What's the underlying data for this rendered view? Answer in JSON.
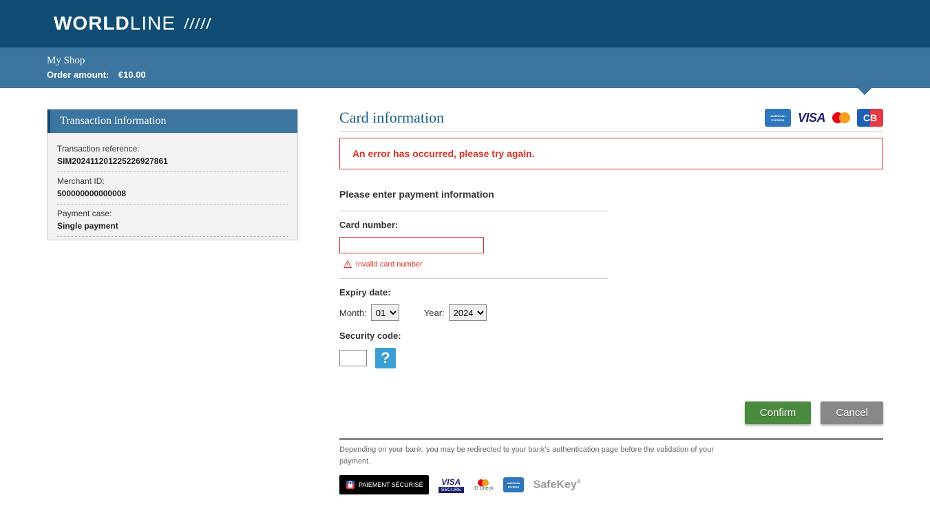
{
  "header": {
    "logo": {
      "bold": "WORLD",
      "light": "LINE"
    }
  },
  "order": {
    "shop_name": "My Shop",
    "amount_label": "Order amount:",
    "amount_value": "€10.00"
  },
  "transaction": {
    "panel_title": "Transaction information",
    "ref_label": "Transaction reference:",
    "ref_value": "SIM202411201225226927861",
    "merchant_label": "Merchant ID:",
    "merchant_value": "500000000000008",
    "case_label": "Payment case:",
    "case_value": "Single payment"
  },
  "card_form": {
    "title": "Card information",
    "error_banner": "An error has occurred, please try again.",
    "instruction": "Please enter payment information",
    "card_number_label": "Card number:",
    "card_number_value": "",
    "card_number_error": "Invalid card number",
    "expiry_label": "Expiry date:",
    "month_label": "Month:",
    "month_value": "01",
    "year_label": "Year:",
    "year_value": "2024",
    "cvv_label": "Security code:",
    "cvv_value": "",
    "help_symbol": "?",
    "confirm_label": "Confirm",
    "cancel_label": "Cancel"
  },
  "footer": {
    "note": "Depending on your bank, you may be redirected to your bank's authentication page before the validation of your payment.",
    "secure_badge": "PAIEMENT SÉCURISÉ",
    "visa_secure": "SECURE",
    "mc_idcheck": "ID Check",
    "safekey": "SafeKey"
  },
  "card_brands": {
    "amex": "AMEX",
    "visa": "VISA",
    "mastercard": "mastercard",
    "cb": "CB"
  }
}
